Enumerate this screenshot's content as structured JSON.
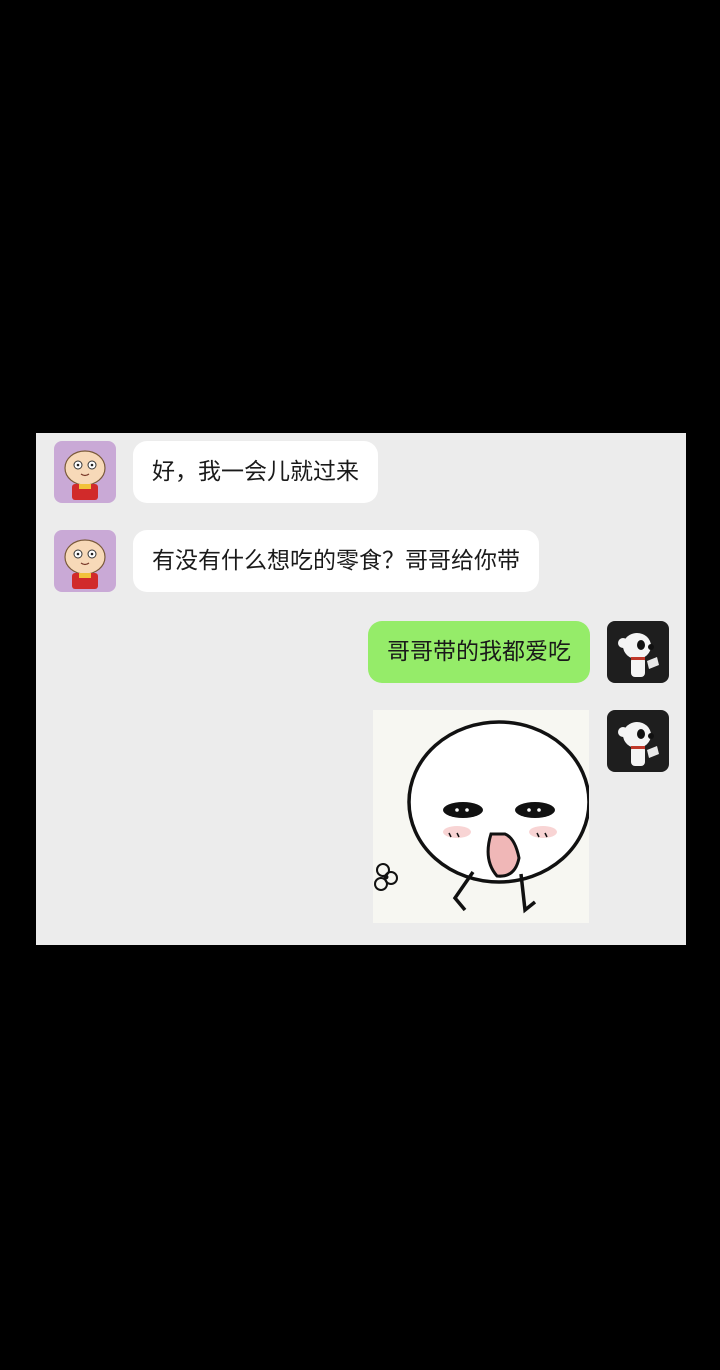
{
  "chat": {
    "messages": [
      {
        "sender": "contact",
        "avatar": "cartoon-baby-avatar",
        "text": "好，我一会儿就过来"
      },
      {
        "sender": "contact",
        "avatar": "cartoon-baby-avatar",
        "text": "有没有什么想吃的零食？哥哥给你带"
      },
      {
        "sender": "self",
        "avatar": "cartoon-dog-avatar",
        "text": "哥哥带的我都爱吃"
      },
      {
        "sender": "self",
        "avatar": "cartoon-dog-avatar",
        "type": "sticker",
        "sticker": "cute-round-face-sticker"
      }
    ]
  },
  "colors": {
    "background": "#000000",
    "chat_bg": "#ececec",
    "incoming_bubble": "#ffffff",
    "outgoing_bubble": "#95ec69"
  }
}
